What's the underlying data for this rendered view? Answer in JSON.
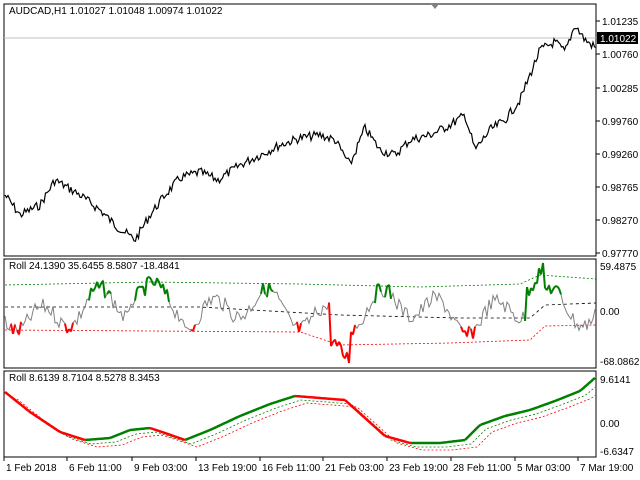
{
  "main_panel": {
    "title": "AUDCAD,H1  1.01027  1.01048  1.00974  1.01022",
    "current_price": "1.01022",
    "price_ticks": [
      "1.01235",
      "1.00760",
      "1.00285",
      "0.99760",
      "0.99260",
      "0.98765",
      "0.98270",
      "0.97770"
    ],
    "colors": {
      "bar": "#000000",
      "grid_line": "#c0c0c0",
      "price_label_bg": "#000000"
    }
  },
  "indicator1": {
    "title": "Roll 24.1390 35.6455 8.5807 -18.4841",
    "ticks": [
      "59.4875",
      "0.00",
      "-68.0862"
    ],
    "colors": {
      "main": "#808080",
      "up": "#008000",
      "down": "#ff0000",
      "upper_band": "#008000",
      "lower_band": "#ff0000"
    }
  },
  "indicator2": {
    "title": "Roll 8.6139 8.7104 8.5278 8.3453",
    "ticks": [
      "9.6141",
      "0.00",
      "-6.6347"
    ],
    "colors": {
      "up": "#008000",
      "down": "#ff0000"
    }
  },
  "time_axis": {
    "labels": [
      "1 Feb 2018",
      "6 Feb 11:00",
      "9 Feb 03:00",
      "13 Feb 19:00",
      "16 Feb 11:00",
      "21 Feb 03:00",
      "23 Feb 19:00",
      "28 Feb 11:00",
      "5 Mar 03:00",
      "7 Mar 19:00"
    ]
  },
  "chart_data": [
    {
      "type": "line",
      "title": "AUDCAD,H1",
      "x": [
        "1 Feb 2018",
        "6 Feb 11:00",
        "9 Feb 03:00",
        "13 Feb 19:00",
        "16 Feb 11:00",
        "21 Feb 03:00",
        "23 Feb 19:00",
        "28 Feb 11:00",
        "5 Mar 03:00",
        "7 Mar 19:00"
      ],
      "series": [
        {
          "values": [
            0.9835,
            0.986,
            0.9805,
            0.989,
            0.9925,
            0.9915,
            0.9945,
            0.994,
            1.006,
            1.01
          ]
        }
      ],
      "ylim": [
        0.977,
        1.0135
      ]
    },
    {
      "type": "line",
      "title": "Roll 24.1390 35.6455 8.5807 -18.4841",
      "ylim": [
        -68.0862,
        59.4875
      ]
    },
    {
      "type": "line",
      "title": "Roll 8.6139 8.7104 8.5278 8.3453",
      "ylim": [
        -6.6347,
        9.6141
      ]
    }
  ]
}
